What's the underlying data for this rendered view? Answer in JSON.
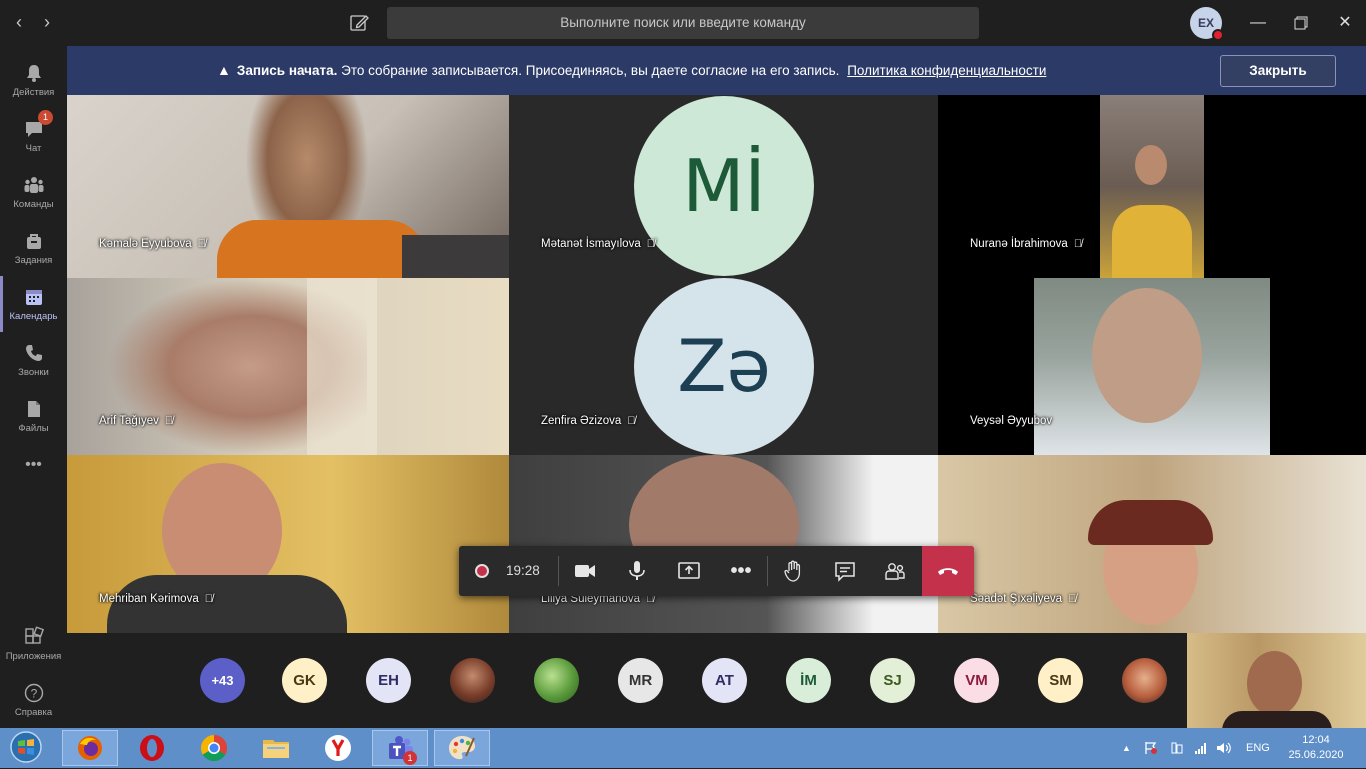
{
  "titlebar": {
    "search_placeholder": "Выполните поиск или введите команду",
    "user_initials": "EX"
  },
  "rail": {
    "items": [
      {
        "label": "Действия",
        "icon": "bell-icon"
      },
      {
        "label": "Чат",
        "icon": "chat-icon",
        "badge": "1"
      },
      {
        "label": "Команды",
        "icon": "teams-icon"
      },
      {
        "label": "Задания",
        "icon": "assignments-icon"
      },
      {
        "label": "Календарь",
        "icon": "calendar-icon"
      },
      {
        "label": "Звонки",
        "icon": "phone-icon"
      },
      {
        "label": "Файлы",
        "icon": "files-icon"
      },
      {
        "label": "Приложения",
        "icon": "apps-icon"
      },
      {
        "label": "Справка",
        "icon": "help-icon"
      }
    ],
    "more": "•••"
  },
  "banner": {
    "bold": "Запись начата.",
    "text": "Это собрание записывается. Присоединяясь, вы даете согласие на его запись.",
    "link": "Политика конфиденциальности",
    "close": "Закрыть"
  },
  "participants": [
    {
      "name": "Kəmalə Eyyubova"
    },
    {
      "name": "Mətanət İsmayılova",
      "initials": "Mİ"
    },
    {
      "name": "Nuranə İbrahimova"
    },
    {
      "name": "Arif Tağıyev"
    },
    {
      "name": "Zenfira Əzizova",
      "initials": "Zə"
    },
    {
      "name": "Veysəl Əyyubov"
    },
    {
      "name": "Mehriban Kərimova"
    },
    {
      "name": "Liliya Süleymanova"
    },
    {
      "name": "Səadət Şıxəliyeva"
    }
  ],
  "controls": {
    "timer": "19:28"
  },
  "roster": [
    "+43",
    "GK",
    "EH",
    "",
    "",
    "MR",
    "AT",
    "İM",
    "SJ",
    "VM",
    "SM",
    ""
  ],
  "taskbar": {
    "lang": "ENG",
    "time": "12:04",
    "date": "25.06.2020",
    "teams_badge": "1"
  },
  "colors": {
    "banner": "#2b3a66",
    "hangup": "#c4314b",
    "accent": "#8b8cc7"
  }
}
